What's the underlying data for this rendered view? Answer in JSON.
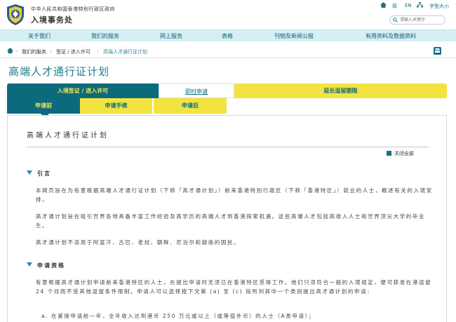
{
  "header": {
    "gov_name": "中华人民共和国香港特别行政区政府",
    "dept_name": "入境事务处",
    "util": {
      "lang_simplified": "简",
      "lang_en": "EN",
      "font_size": "字型大小"
    },
    "search_placeholder": "请输入关键字"
  },
  "nav": {
    "items": [
      "关于我们",
      "我们的服务",
      "网上服务",
      "表格",
      "刊物及新闻公报",
      "有用资料及数据资料"
    ]
  },
  "breadcrumb": [
    "我们的服务",
    "签证 / 进入许可",
    "高端人才通行证计划"
  ],
  "page_title": "高端人才通行证计划",
  "tabs": {
    "row1": [
      "入境签证 / 进入许可",
      "即时申请",
      "延长逗留期限"
    ],
    "row2": [
      "申请前",
      "申请手续",
      "申请后"
    ]
  },
  "panel": {
    "title": "高端人才通行证计划",
    "collapse_all": "关闭全部",
    "sections": [
      {
        "heading": "引言",
        "paragraphs": [
          "本网页旨在为有意根据高端人才通行证计划（下称「高才通计划」）前来香港特别行政区（下称「香港特区」）就业的人士，概述有关的入境安排。",
          "高才通计划旨在吸引世界各地具备丰富工作经验及高学历的高端人才到香港探索机遇。这些高端人才包括高收入人士和世界顶尖大学的毕业生。",
          "高才通计划不适用于阿富汗、古巴、老挝、朝鲜、尼泊尔和越南的国民。"
        ]
      },
      {
        "heading": "申请资格",
        "paragraphs": [
          "有意根据高才通计划申请前来香港特区的人士，在提出申请时无须已在香港特区觅得工作。他们只须符合一般的入境规定，便可获准在港逗留 24 个月而不受其他逗留条件限制。申请人可以选择按下文第 (a) 至 (c) 段所列其中一个类别提出高才通计划的申请：",
          "a.  在紧接申请前一年，全年收入达到港币 250 万元或以上（或等值外币）的人士（A类申请）；"
        ]
      }
    ]
  }
}
